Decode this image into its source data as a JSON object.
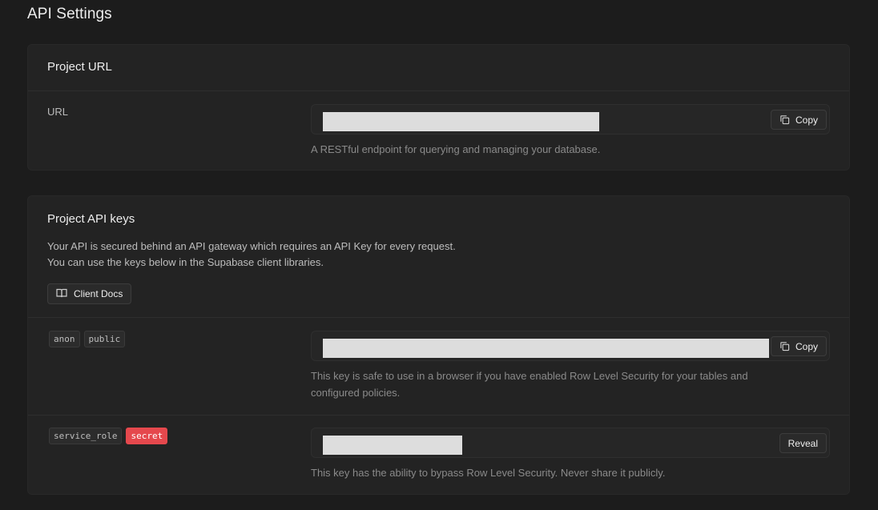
{
  "page": {
    "title": "API Settings"
  },
  "project_url": {
    "heading": "Project URL",
    "url_label": "URL",
    "copy_label": "Copy",
    "help": "A RESTful endpoint for querying and managing your database."
  },
  "api_keys": {
    "heading": "Project API keys",
    "description_line1": "Your API is secured behind an API gateway which requires an API Key for every request.",
    "description_line2": "You can use the keys below in the Supabase client libraries.",
    "docs_button": "Client Docs",
    "anon": {
      "badges": [
        "anon",
        "public"
      ],
      "copy_label": "Copy",
      "help_line1": "This key is safe to use in a browser if you have enabled Row Level Security for your tables and",
      "help_line2": "configured policies."
    },
    "service": {
      "badges": [
        "service_role",
        "secret"
      ],
      "reveal_label": "Reveal",
      "help": "This key has the ability to bypass Row Level Security. Never share it publicly."
    }
  },
  "icons": {
    "copy": "copy-icon",
    "book": "book-icon"
  },
  "colors": {
    "background": "#1c1c1c",
    "panel": "#232323",
    "secret_badge": "#e5484d"
  }
}
